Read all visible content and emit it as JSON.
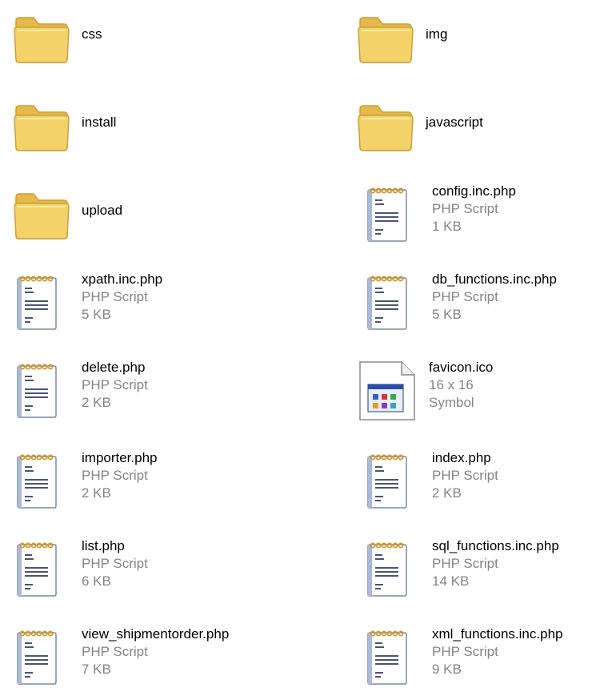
{
  "colors": {
    "name": "#000000",
    "meta": "#848484",
    "folder_body": "#f4d26a",
    "folder_edge": "#c9a13b",
    "paper": "#ffffff",
    "paper_edge": "#7a8aa8",
    "ring": "#d29a2a"
  },
  "items": [
    {
      "kind": "folder",
      "icon": "folder-icon",
      "name": "css"
    },
    {
      "kind": "folder",
      "icon": "folder-icon",
      "name": "img"
    },
    {
      "kind": "folder",
      "icon": "folder-icon",
      "name": "install"
    },
    {
      "kind": "folder",
      "icon": "folder-icon",
      "name": "javascript"
    },
    {
      "kind": "folder",
      "icon": "folder-icon",
      "name": "upload"
    },
    {
      "kind": "file",
      "icon": "php-script-icon",
      "name": "config.inc.php",
      "type": "PHP Script",
      "size": "1 KB"
    },
    {
      "kind": "file",
      "icon": "php-script-icon",
      "name": "xpath.inc.php",
      "type": "PHP Script",
      "size": "5 KB"
    },
    {
      "kind": "file",
      "icon": "php-script-icon",
      "name": "db_functions.inc.php",
      "type": "PHP Script",
      "size": "5 KB"
    },
    {
      "kind": "file",
      "icon": "php-script-icon",
      "name": "delete.php",
      "type": "PHP Script",
      "size": "2 KB"
    },
    {
      "kind": "file",
      "icon": "symbol-file-icon",
      "name": "favicon.ico",
      "type": "16 x 16",
      "size": "Symbol"
    },
    {
      "kind": "file",
      "icon": "php-script-icon",
      "name": "importer.php",
      "type": "PHP Script",
      "size": "2 KB"
    },
    {
      "kind": "file",
      "icon": "php-script-icon",
      "name": "index.php",
      "type": "PHP Script",
      "size": "2 KB"
    },
    {
      "kind": "file",
      "icon": "php-script-icon",
      "name": "list.php",
      "type": "PHP Script",
      "size": "6 KB"
    },
    {
      "kind": "file",
      "icon": "php-script-icon",
      "name": "sql_functions.inc.php",
      "type": "PHP Script",
      "size": "14 KB"
    },
    {
      "kind": "file",
      "icon": "php-script-icon",
      "name": "view_shipmentorder.php",
      "type": "PHP Script",
      "size": "7 KB"
    },
    {
      "kind": "file",
      "icon": "php-script-icon",
      "name": "xml_functions.inc.php",
      "type": "PHP Script",
      "size": "9 KB"
    }
  ]
}
